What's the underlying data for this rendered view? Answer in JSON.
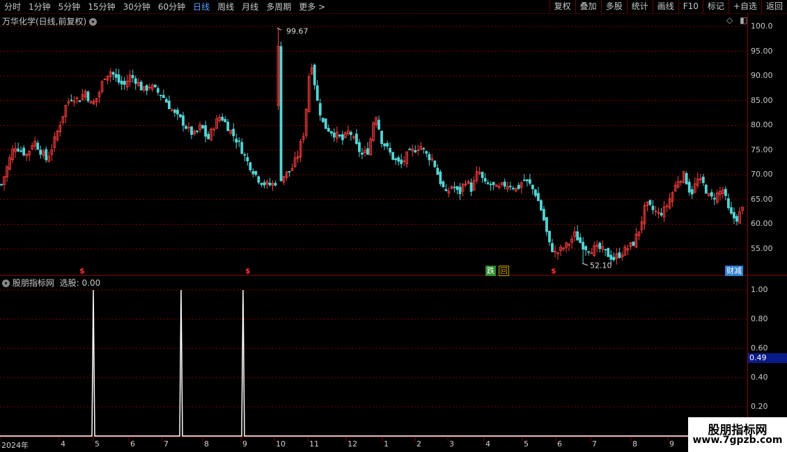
{
  "toolbar": {
    "periods": [
      "分时",
      "1分钟",
      "5分钟",
      "15分钟",
      "30分钟",
      "60分钟",
      "日线",
      "周线",
      "月线",
      "多周期",
      "更多 >"
    ],
    "active_period": "日线",
    "actions": [
      "复权",
      "叠加",
      "多股",
      "统计",
      "画线",
      "F10",
      "标记",
      "+自选",
      "返回"
    ]
  },
  "main_panel": {
    "title": "万华化学(日线,前复权)",
    "high_label": "99.67",
    "low_label": "52.10",
    "signal_mark": "$",
    "event_tags": [
      {
        "text": "跌",
        "color": "#2e8b2e"
      },
      {
        "text": "回",
        "color": "#c8a000"
      },
      {
        "text": "财减",
        "color": "#2e7fd0"
      }
    ],
    "y_labels": [
      "100.0",
      "95.00",
      "90.00",
      "85.00",
      "80.00",
      "75.00",
      "70.00",
      "65.00",
      "60.00",
      "55.00"
    ]
  },
  "indicator_panel": {
    "title": "股朋指标网",
    "value_label": "选股: 0.00",
    "y_labels": [
      "1.00",
      "0.80",
      "0.60",
      "0.40",
      "0.20"
    ],
    "current_value": "0.49"
  },
  "x_axis": {
    "labels": [
      "2024年",
      "4",
      "5",
      "6",
      "7",
      "8",
      "9",
      "10",
      "11",
      "12",
      "1",
      "2",
      "3",
      "4",
      "5",
      "6",
      "7",
      "8",
      "9"
    ]
  },
  "watermark": {
    "line1": "股朋指标网",
    "line2": "www.7gpzb.com"
  },
  "colors": {
    "up": "#ff4040",
    "down": "#54d4d4",
    "grid": "#8a0000",
    "indicator": "#ffffff",
    "active": "#5aa0ff"
  },
  "chart_data": [
    {
      "type": "candlestick",
      "title": "万华化学(日线,前复权)",
      "xlabel": "",
      "ylabel": "",
      "ylim": [
        51,
        101
      ],
      "x_ticks": [
        "2024年",
        "4",
        "5",
        "6",
        "7",
        "8",
        "9",
        "10",
        "11",
        "12",
        "1",
        "2",
        "3",
        "4",
        "5",
        "6",
        "7",
        "8",
        "9"
      ],
      "close_path": [
        68,
        72,
        76,
        75,
        74,
        77,
        75,
        73,
        76,
        80,
        84,
        86,
        85,
        87,
        84,
        86,
        90,
        91,
        89,
        88,
        90,
        89,
        87,
        88,
        87,
        86,
        84,
        82,
        81,
        79,
        78,
        80,
        77,
        80,
        82,
        80,
        78,
        76,
        73,
        71,
        69,
        68,
        68,
        69,
        70,
        71,
        74,
        79,
        94,
        85,
        80,
        79,
        78,
        77,
        79,
        76,
        74,
        75,
        83,
        77,
        75,
        73,
        72,
        74,
        75,
        76,
        74,
        73,
        69,
        66,
        68,
        66,
        69,
        67,
        71,
        68,
        68,
        67,
        68,
        68,
        67,
        69,
        68,
        66,
        62,
        56,
        54,
        55,
        56,
        58,
        56,
        55,
        55,
        55,
        54,
        53,
        54,
        55,
        56,
        59,
        64,
        63,
        62,
        63,
        66,
        69,
        70,
        66,
        69,
        68,
        65,
        66,
        67,
        62,
        61,
        63
      ],
      "annotated_high": 99.67,
      "annotated_low": 52.1
    },
    {
      "type": "line",
      "title": "股朋指标网",
      "series": [
        {
          "name": "选股",
          "peaks_at_x_index": [
            2.6,
            5.1,
            6.9
          ],
          "peak_value": 1.0,
          "base_value": 0.0
        }
      ],
      "ylim": [
        0,
        1.05
      ],
      "current_value": 0.49
    }
  ]
}
